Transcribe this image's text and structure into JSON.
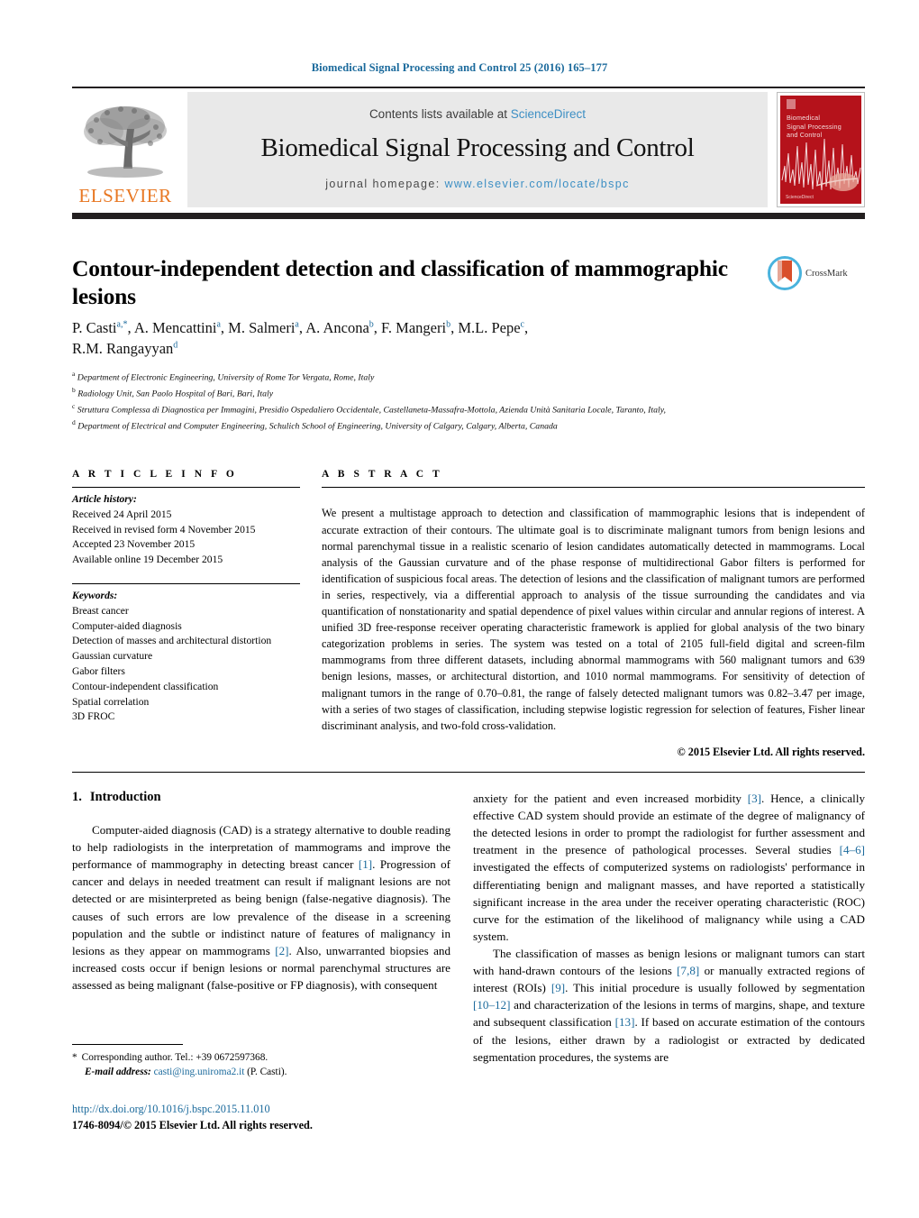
{
  "running_head": "Biomedical Signal Processing and Control 25 (2016) 165–177",
  "masthead": {
    "publisher_logo_text": "ELSEVIER",
    "contents_prefix": "Contents lists available at ",
    "contents_link": "ScienceDirect",
    "journal_title": "Biomedical Signal Processing and Control",
    "homepage_prefix": "journal homepage:",
    "homepage_url": "www.elsevier.com/locate/bspc",
    "cover": {
      "title_lines": [
        "Biomedical",
        "Signal Processing",
        "and Control"
      ],
      "footer_text": "ScienceDirect",
      "bg_color": "#b5121b"
    }
  },
  "article": {
    "title": "Contour-independent detection and classification of mammographic lesions",
    "crossmark_label": "CrossMark",
    "authors_line1": "P. Casti",
    "authors_html": "P. Casti<sup class=\"aff\">a</sup><sup class=\"star\">,*</sup>, A. Mencattini<sup class=\"aff\">a</sup>, M. Salmeri<sup class=\"aff\">a</sup>, A. Ancona<sup class=\"aff\">b</sup>, F. Mangeri<sup class=\"aff\">b</sup>, M.L. Pepe<sup class=\"aff\">c</sup>,<br>R.M. Rangayyan<sup class=\"aff\">d</sup>",
    "affiliations": [
      {
        "marker": "a",
        "text": "Department of Electronic Engineering, University of Rome Tor Vergata, Rome, Italy"
      },
      {
        "marker": "b",
        "text": "Radiology Unit, San Paolo Hospital of Bari, Bari, Italy"
      },
      {
        "marker": "c",
        "text": "Struttura Complessa di Diagnostica per Immagini, Presidio Ospedaliero Occidentale, Castellaneta-Massafra-Mottola, Azienda Unità Sanitaria Locale, Taranto, Italy,"
      },
      {
        "marker": "d",
        "text": "Department of Electrical and Computer Engineering, Schulich School of Engineering, University of Calgary, Calgary, Alberta, Canada"
      }
    ]
  },
  "article_info": {
    "heading": "A R T I C L E   I N F O",
    "history_label": "Article history:",
    "history": [
      "Received 24 April 2015",
      "Received in revised form 4 November 2015",
      "Accepted 23 November 2015",
      "Available online 19 December 2015"
    ],
    "keywords_label": "Keywords:",
    "keywords": [
      "Breast cancer",
      "Computer-aided diagnosis",
      "Detection of masses and architectural distortion",
      "Gaussian curvature",
      "Gabor filters",
      "Contour-independent classification",
      "Spatial correlation",
      "3D FROC"
    ]
  },
  "abstract": {
    "heading": "A B S T R A C T",
    "text": "We present a multistage approach to detection and classification of mammographic lesions that is independent of accurate extraction of their contours. The ultimate goal is to discriminate malignant tumors from benign lesions and normal parenchymal tissue in a realistic scenario of lesion candidates automatically detected in mammograms. Local analysis of the Gaussian curvature and of the phase response of multidirectional Gabor filters is performed for identification of suspicious focal areas. The detection of lesions and the classification of malignant tumors are performed in series, respectively, via a differential approach to analysis of the tissue surrounding the candidates and via quantification of nonstationarity and spatial dependence of pixel values within circular and annular regions of interest. A unified 3D free-response receiver operating characteristic framework is applied for global analysis of the two binary categorization problems in series. The system was tested on a total of 2105 full-field digital and screen-film mammograms from three different datasets, including abnormal mammograms with 560 malignant tumors and 639 benign lesions, masses, or architectural distortion, and 1010 normal mammograms. For sensitivity of detection of malignant tumors in the range of 0.70–0.81, the range of falsely detected malignant tumors was 0.82–3.47 per image, with a series of two stages of classification, including stepwise logistic regression for selection of features, Fisher linear discriminant analysis, and two-fold cross-validation.",
    "copyright": "© 2015 Elsevier Ltd. All rights reserved."
  },
  "body": {
    "section_number": "1.",
    "section_title": "Introduction",
    "left_paragraphs": [
      "Computer-aided diagnosis (CAD) is a strategy alternative to double reading to help radiologists in the interpretation of mammograms and improve the performance of mammography in detecting breast cancer [1]. Progression of cancer and delays in needed treatment can result if malignant lesions are not detected or are misinterpreted as being benign (false-negative diagnosis). The causes of such errors are low prevalence of the disease in a screening population and the subtle or indistinct nature of features of malignancy in lesions as they appear on mammograms [2]. Also, unwarranted biopsies and increased costs occur if benign lesions or normal parenchymal structures are assessed as being malignant (false-positive or FP diagnosis), with consequent"
    ],
    "right_paragraphs": [
      "anxiety for the patient and even increased morbidity [3]. Hence, a clinically effective CAD system should provide an estimate of the degree of malignancy of the detected lesions in order to prompt the radiologist for further assessment and treatment in the presence of pathological processes. Several studies [4–6] investigated the effects of computerized systems on radiologists' performance in differentiating benign and malignant masses, and have reported a statistically significant increase in the area under the receiver operating characteristic (ROC) curve for the estimation of the likelihood of malignancy while using a CAD system.",
      "The classification of masses as benign lesions or malignant tumors can start with hand-drawn contours of the lesions [7,8] or manually extracted regions of interest (ROIs) [9]. This initial procedure is usually followed by segmentation [10–12] and characterization of the lesions in terms of margins, shape, and texture and subsequent classification [13]. If based on accurate estimation of the contours of the lesions, either drawn by a radiologist or extracted by dedicated segmentation procedures, the systems are"
    ]
  },
  "footnote": {
    "star": "*",
    "corresponding": "Corresponding author. Tel.: +39 0672597368.",
    "email_label": "E-mail address:",
    "email": "casti@ing.uniroma2.it",
    "email_suffix": "(P. Casti)."
  },
  "footer": {
    "doi_url": "http://dx.doi.org/10.1016/j.bspc.2015.11.010",
    "issn_line": "1746-8094/© 2015 Elsevier Ltd. All rights reserved."
  },
  "colors": {
    "link_blue": "#1b6a9c",
    "sciencedirect_blue": "#3d8fc4",
    "elsevier_orange": "#e87722",
    "cover_red": "#b5121b",
    "rule_black": "#231f20"
  }
}
